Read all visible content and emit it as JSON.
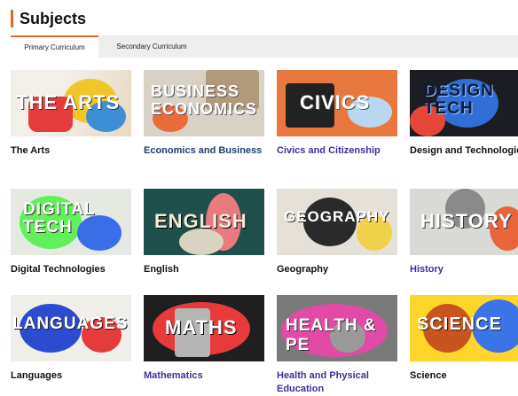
{
  "header": {
    "title": "Subjects"
  },
  "tabs": [
    {
      "label": "Primary Curriculum",
      "active": true
    },
    {
      "label": "Secondary Curriculum",
      "active": false
    }
  ],
  "accent_color": "#e8662b",
  "cards": [
    {
      "label": "The Arts",
      "thumb_text": "THE ARTS"
    },
    {
      "label": "Economics and Business",
      "thumb_text": "BUSINESS ECONOMICS"
    },
    {
      "label": "Civics and Citizenship",
      "thumb_text": "CIVICS"
    },
    {
      "label": "Design and Technologies",
      "thumb_text": "DESIGN TECH"
    },
    {
      "label": "Digital Technologies",
      "thumb_text": "DIGITAL TECH"
    },
    {
      "label": "English",
      "thumb_text": "ENGLISH"
    },
    {
      "label": "Geography",
      "thumb_text": "GEOGRAPHY"
    },
    {
      "label": "History",
      "thumb_text": "HISTORY"
    },
    {
      "label": "Languages",
      "thumb_text": "LANGUAGES"
    },
    {
      "label": "Mathematics",
      "thumb_text": "MATHS"
    },
    {
      "label": "Health and Physical Education",
      "thumb_text": "HEALTH & PE"
    },
    {
      "label": "Science",
      "thumb_text": "SCIENCE"
    }
  ]
}
